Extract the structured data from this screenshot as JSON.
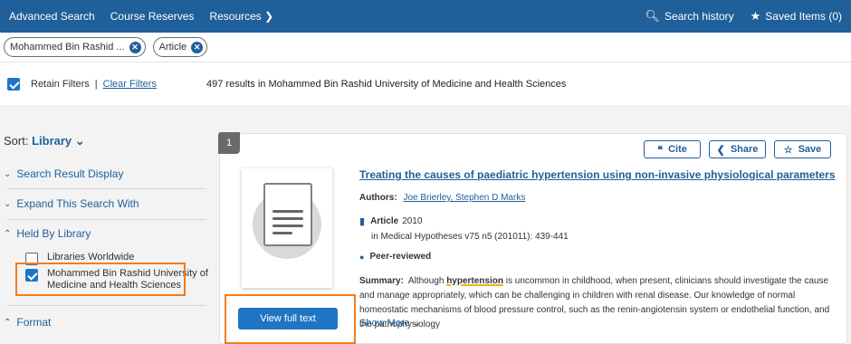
{
  "nav": {
    "items": [
      "Advanced Search",
      "Course Reserves",
      "Resources"
    ],
    "resources_chevron": "chevron-down-icon",
    "search_history": "Search history",
    "saved_items": "Saved Items (0)"
  },
  "chips": [
    "Mohammed Bin Rashid ...",
    "Article"
  ],
  "filters": {
    "retain_label": "Retain Filters",
    "retain_checked": true,
    "clear_label": "Clear Filters",
    "result_count": "497 results in Mohammed Bin Rashid University of Medicine and Health Sciences"
  },
  "sidebar": {
    "sort_label": "Sort:",
    "sort_value": "Library",
    "facets": {
      "display": "Search Result Display",
      "expand": "Expand This Search With",
      "held": "Held By Library",
      "format": "Format"
    },
    "library_options": [
      {
        "label": "Libraries Worldwide",
        "checked": false
      },
      {
        "label_line1": "Mohammed Bin Rashid University of",
        "label_line2": "Medicine and Health Sciences",
        "checked": true
      }
    ],
    "highlight_color": "#f07d22"
  },
  "result": {
    "number": "1",
    "actions": {
      "cite": "Cite",
      "share": "Share",
      "save": "Save"
    },
    "title_part1": "Treating the causes of ",
    "title_hl": "paediatric hypertension",
    "title_part2": " using non-invasive physiological parameters",
    "authors_label": "Authors:",
    "authors": "Joe Brierley, Stephen D Marks",
    "type": "Article",
    "year": "2010",
    "published_in": "in Medical Hypotheses v75 n5 (201011): 439-441",
    "peer_reviewed": "Peer-reviewed",
    "summary_label": "Summary:",
    "summary_pre": "Although ",
    "summary_hl": "hypertension",
    "summary_post": " is uncommon in childhood, when present, clinicians should investigate the cause and manage appropriately, which can be challenging in children with renal disease. Our knowledge of normal homeostatic mechanisms of blood pressure control, such as the renin-angiotensin system or endothelial function, and the pathophysiology",
    "show_more": "Show More",
    "view_full_text": "View full text"
  },
  "colors": {
    "brand": "#1f5f9a",
    "button": "#1f75c4",
    "highlight": "#f07d22",
    "keyword_underline": "#f2b21b"
  }
}
